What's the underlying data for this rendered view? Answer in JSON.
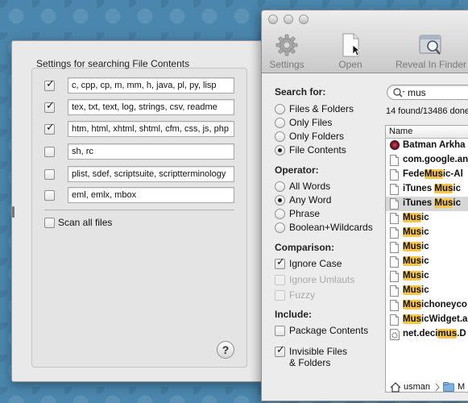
{
  "settings_sheet": {
    "title": "Settings for searching File Contents",
    "extension_rows": [
      {
        "checked": true,
        "value": "c, cpp, cp, m, mm, h, java, pl, py, lisp"
      },
      {
        "checked": true,
        "value": "tex, txt, text, log, strings, csv, readme"
      },
      {
        "checked": true,
        "value": "htm, html, xhtml, shtml, cfm, css, js, php"
      },
      {
        "checked": false,
        "value": "sh, rc"
      },
      {
        "checked": false,
        "value": "plist, sdef, scriptsuite, scriptterminology"
      },
      {
        "checked": false,
        "value": "eml, emlx, mbox"
      }
    ],
    "scan_all_label": "Scan all files",
    "help_label": "?"
  },
  "toolbar": {
    "settings_label": "Settings",
    "open_label": "Open",
    "reveal_label": "Reveal In Finder"
  },
  "search_for": {
    "title": "Search for:",
    "options": [
      "Files & Folders",
      "Only Files",
      "Only Folders",
      "File Contents"
    ],
    "selected": "File Contents"
  },
  "operator": {
    "title": "Operator:",
    "options": [
      "All Words",
      "Any Word",
      "Phrase",
      "Boolean+Wildcards"
    ],
    "selected": "Any Word"
  },
  "comparison": {
    "title": "Comparison:",
    "ignore_case": "Ignore Case",
    "ignore_umlauts": "Ignore Umlauts",
    "fuzzy": "Fuzzy"
  },
  "include": {
    "title": "Include:",
    "package_contents": "Package Contents",
    "invisible_line1": "Invisible Files",
    "invisible_line2": "& Folders"
  },
  "search": {
    "query": "mus",
    "found_text": "14 found/13486 done"
  },
  "results": {
    "column_name": "Name",
    "rows": [
      {
        "pre": "Batman Arkha",
        "hl": "",
        "post": "",
        "icon": "app-icon"
      },
      {
        "pre": "com.google.an",
        "hl": "",
        "post": "",
        "icon": "document-icon"
      },
      {
        "pre": "Fede",
        "hl": "Mus",
        "post": "ic-Al",
        "icon": "document-icon"
      },
      {
        "pre": "iTunes ",
        "hl": "Mus",
        "post": "ic",
        "icon": "document-icon"
      },
      {
        "pre": "iTunes ",
        "hl": "Mus",
        "post": "ic",
        "icon": "document-icon"
      },
      {
        "pre": "",
        "hl": "Mus",
        "post": "ic",
        "icon": "document-icon"
      },
      {
        "pre": "",
        "hl": "Mus",
        "post": "ic",
        "icon": "document-icon"
      },
      {
        "pre": "",
        "hl": "Mus",
        "post": "ic",
        "icon": "document-icon"
      },
      {
        "pre": "",
        "hl": "Mus",
        "post": "ic",
        "icon": "document-icon"
      },
      {
        "pre": "",
        "hl": "Mus",
        "post": "ic",
        "icon": "document-icon"
      },
      {
        "pre": "",
        "hl": "Mus",
        "post": "ic",
        "icon": "document-icon"
      },
      {
        "pre": "",
        "hl": "Mus",
        "post": "ichoneyco",
        "icon": "document-icon"
      },
      {
        "pre": "",
        "hl": "Mus",
        "post": "icWidget.a",
        "icon": "document-icon"
      },
      {
        "pre": "net.deci",
        "hl": "mus",
        "post": ".D",
        "icon": "gear-document-icon"
      }
    ]
  },
  "pathbar": {
    "home": "usman",
    "next": "M"
  }
}
